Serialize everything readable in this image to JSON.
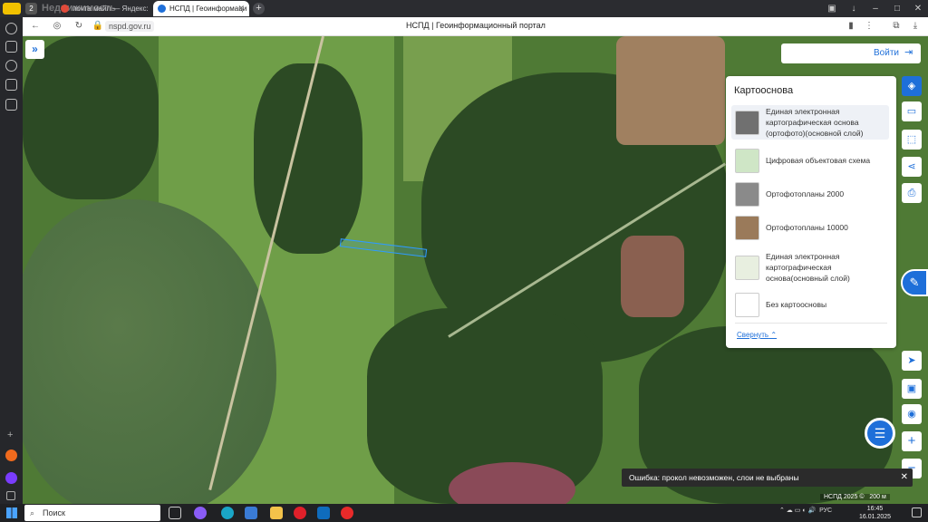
{
  "browser": {
    "badge": "2",
    "tabs": [
      {
        "label": "почта майл — Яндекс: на",
        "active": false,
        "favicon_color": "#e04a3a"
      },
      {
        "label": "НСПД | Геоинформаци",
        "active": true,
        "favicon_color": "#1e6fd9"
      }
    ],
    "new_tab_label": "+",
    "url": "nspd.gov.ru",
    "page_title": "НСПД | Геоинформационный портал",
    "overlay_logo": "Недвижимость"
  },
  "header": {
    "expand_label": "»",
    "login_label": "Войти"
  },
  "basemap_panel": {
    "title": "Картооснова",
    "items": [
      {
        "label": "Единая электронная картографическая основа (ортофото)(основной слой)",
        "selected": true,
        "thumb": "ortho"
      },
      {
        "label": "Цифровая объектовая схема",
        "selected": false,
        "thumb": "scheme"
      },
      {
        "label": "Ортофотопланы 2000",
        "selected": false,
        "thumb": "ortho2000"
      },
      {
        "label": "Ортофотопланы 10000",
        "selected": false,
        "thumb": "ortho10000"
      },
      {
        "label": "Единая электронная картографическая основа(основный слой)",
        "selected": false,
        "thumb": "map"
      },
      {
        "label": "Без картоосновы",
        "selected": false,
        "thumb": "none"
      }
    ],
    "collapse_label": "Свернуть"
  },
  "toast": {
    "message": "Ошибка: прокол невозможен, слои не выбраны",
    "close_label": "✕"
  },
  "attribution": {
    "source": "НСПД 2025 ©",
    "scale": "200 м"
  },
  "taskbar": {
    "search_placeholder": "Поиск",
    "lang": "РУС",
    "time": "16:45",
    "date": "16.01.2025"
  },
  "colors": {
    "accent": "#1e6fd9",
    "parcel": "#2f9bff"
  }
}
